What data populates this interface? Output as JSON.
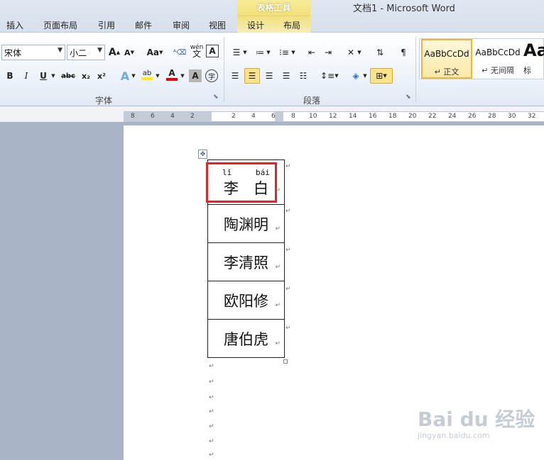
{
  "window": {
    "doc_title": "文档1  -  Microsoft Word",
    "context_group": "表格工具"
  },
  "tabs": [
    {
      "label": "插入"
    },
    {
      "label": "页面布局"
    },
    {
      "label": "引用"
    },
    {
      "label": "邮件"
    },
    {
      "label": "审阅"
    },
    {
      "label": "视图"
    },
    {
      "label": "设计"
    },
    {
      "label": "布局"
    }
  ],
  "font_group": {
    "font_name": "宋体",
    "font_size": "小二",
    "label": "字体",
    "grow_label": "A",
    "shrink_label": "A",
    "case_label": "Aa",
    "pinyin_label": "wén",
    "border_char_label": "A",
    "bold": "B",
    "italic": "I",
    "underline": "U",
    "strike": "abc",
    "subscript": "x₂",
    "superscript": "x²",
    "highlight_text": "ab",
    "font_color_text": "A",
    "shading_text": "A",
    "enclose_text": "字"
  },
  "paragraph_group": {
    "label": "段落"
  },
  "styles": [
    {
      "sample": "AaBbCcDd",
      "name": "↵ 正文",
      "active": true
    },
    {
      "sample": "AaBbCcDd",
      "name": "↵ 无间隔",
      "active": false
    },
    {
      "sample": "Aa",
      "name": "标",
      "active": false
    }
  ],
  "ruler": {
    "labels": [
      "8",
      "6",
      "4",
      "2",
      "2",
      "4",
      "6",
      "8",
      "10",
      "12",
      "14",
      "16",
      "18",
      "20",
      "22",
      "24",
      "26",
      "28",
      "30",
      "32"
    ]
  },
  "table": {
    "rows": [
      {
        "text": "李　白",
        "pinyin_left": "lǐ",
        "pinyin_right": "bái"
      },
      {
        "text": "陶渊明"
      },
      {
        "text": "李清照"
      },
      {
        "text": "欧阳修"
      },
      {
        "text": "唐伯虎"
      }
    ],
    "return_mark": "↵"
  },
  "watermark": {
    "main": "Bai du 经验",
    "sub": "jingyan.baidu.com"
  },
  "colors": {
    "highlight_box": "#e0262c",
    "context_tab": "#f1e07a",
    "selected_button": "#fde48a"
  }
}
